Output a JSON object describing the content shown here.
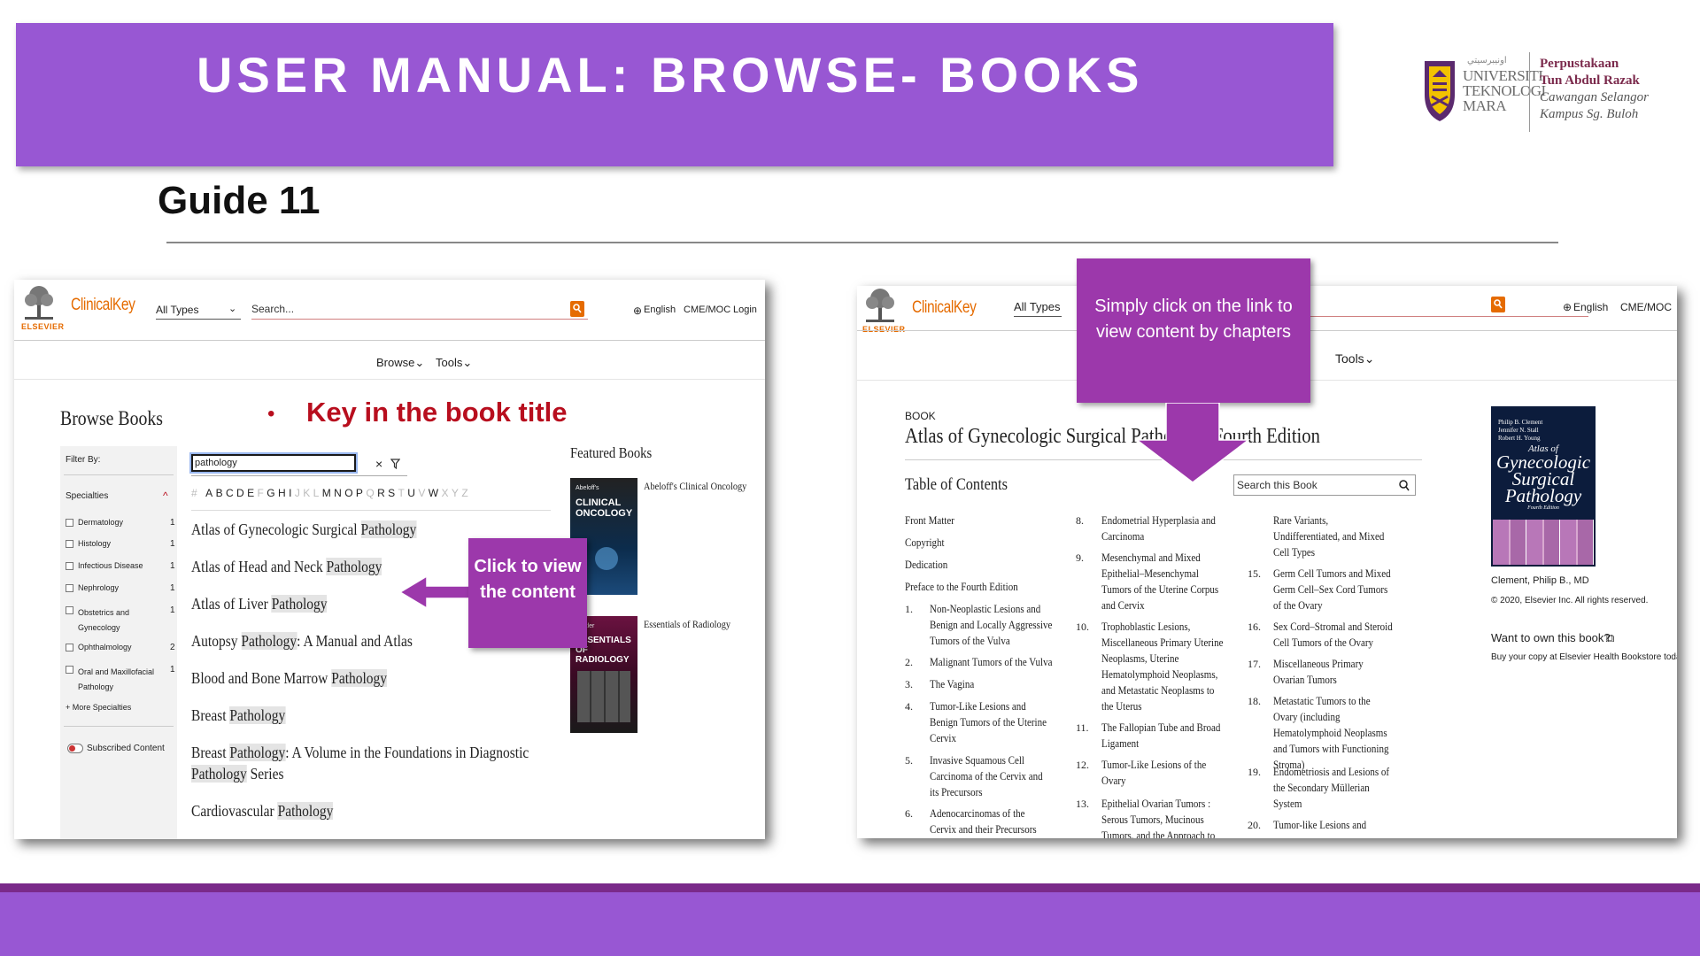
{
  "slide": {
    "title": "USER MANUAL: BROWSE- BOOKS",
    "guide": "Guide 11",
    "bullet": "Key in the book title",
    "callout_left": "Click to view the content",
    "callout_right": "Simply click on the link to view content by chapters",
    "accent_color": "#9857d3",
    "callout_color": "#9c38ab",
    "bullet_color": "#b80e1e"
  },
  "logo": {
    "university": [
      "UNIVERSITI",
      "TEKNOLOGI",
      "MARA"
    ],
    "library": [
      "Perpustakaan",
      "Tun Abdul Razak",
      "Cawangan Selangor",
      "Kampus Sg. Buloh"
    ],
    "crest": "uitm-crest-icon"
  },
  "left_shot": {
    "brand": "ClinicalKey",
    "publisher": "ELSEVIER",
    "type_select": "All Types",
    "search_placeholder": "Search...",
    "lang": "English",
    "cme": "CME/MOC",
    "login": "Login",
    "nav": [
      "Browse",
      "Tools"
    ],
    "heading": "Browse Books",
    "filter_by": "Filter By:",
    "specialties_label": "Specialties",
    "specialties": [
      {
        "name": "Dermatology",
        "count": "1"
      },
      {
        "name": "Histology",
        "count": "1"
      },
      {
        "name": "Infectious Disease",
        "count": "1"
      },
      {
        "name": "Nephrology",
        "count": "1"
      },
      {
        "name": "Obstetrics and Gynecology",
        "count": "1"
      },
      {
        "name": "Ophthalmology",
        "count": "2"
      },
      {
        "name": "Oral and Maxillofacial Pathology",
        "count": "1"
      }
    ],
    "more": "+ More Specialties",
    "subscribed": "Subscribed Content",
    "search_value": "pathology",
    "alphabet": [
      "#",
      "A",
      "B",
      "C",
      "D",
      "E",
      "F",
      "G",
      "H",
      "I",
      "J",
      "K",
      "L",
      "M",
      "N",
      "O",
      "P",
      "Q",
      "R",
      "S",
      "T",
      "U",
      "V",
      "W",
      "X",
      "Y",
      "Z"
    ],
    "alphabet_dim": [
      "#",
      "F",
      "J",
      "K",
      "L",
      "Q",
      "T",
      "V",
      "X",
      "Y",
      "Z"
    ],
    "books": [
      {
        "pre": "Atlas of Gynecologic Surgical ",
        "hl": "Pathology",
        "post": ""
      },
      {
        "pre": "Atlas of Head and Neck ",
        "hl": "Pathology",
        "post": ""
      },
      {
        "pre": "Atlas of Liver ",
        "hl": "Pathology",
        "post": ""
      },
      {
        "pre": "Autopsy ",
        "hl": "Pathology",
        "post": ": A Manual and Atlas"
      },
      {
        "pre": "Blood and Bone Marrow ",
        "hl": "Pathology",
        "post": ""
      },
      {
        "pre": "Breast ",
        "hl": "Pathology",
        "post": ""
      },
      {
        "pre": "Breast ",
        "hl": "Pathology",
        "post": ": A Volume in the Foundations in Diagnostic"
      },
      {
        "pre": "",
        "hl": "Pathology",
        "post": " Series"
      },
      {
        "pre": "Cardiovascular ",
        "hl": "Pathology",
        "post": ""
      }
    ],
    "featured": "Featured Books",
    "featured_books": [
      {
        "caption": "Abeloff's Clinical Oncology",
        "cover_top": "Abeloff's",
        "cover_main": "CLINICAL ONCOLOGY"
      },
      {
        "caption": "Essentials of Radiology",
        "cover_top": "Mettler",
        "cover_main": "ESSENTIALS OF RADIOLOGY"
      }
    ]
  },
  "right_shot": {
    "brand": "ClinicalKey",
    "publisher": "ELSEVIER",
    "type_select": "All Types",
    "lang": "English",
    "cme": "CME/MOC",
    "nav_tools": "Tools",
    "book_label": "BOOK",
    "book_title": "Atlas of Gynecologic Surgical Pathology, Fourth Edition",
    "toc_heading": "Table of Contents",
    "toc_search": "Search this Book",
    "front": [
      "Front Matter",
      "Copyright",
      "Dedication",
      "Preface to the Fourth Edition"
    ],
    "col1": [
      {
        "n": "1.",
        "t": "Non-Neoplastic Lesions and Benign and Locally Aggressive Tumors of the Vulva"
      },
      {
        "n": "2.",
        "t": "Malignant Tumors of the Vulva"
      },
      {
        "n": "3.",
        "t": "The Vagina"
      },
      {
        "n": "4.",
        "t": "Tumor-Like Lesions and Benign Tumors of the Uterine Cervix"
      },
      {
        "n": "5.",
        "t": "Invasive Squamous Cell Carcinoma of the Cervix and its Precursors"
      },
      {
        "n": "6.",
        "t": "Adenocarcinomas of the Cervix and their Precursors and"
      }
    ],
    "col2": [
      {
        "n": "8.",
        "t": "Endometrial Hyperplasia and Carcinoma"
      },
      {
        "n": "9.",
        "t": "Mesenchymal and Mixed Epithelial–Mesenchymal Tumors of the Uterine Corpus and Cervix"
      },
      {
        "n": "10.",
        "t": "Trophoblastic Lesions, Miscellaneous Primary Uterine Neoplasms, Uterine Hematolymphoid Neoplasms, and Metastatic Neoplasms to the Uterus"
      },
      {
        "n": "11.",
        "t": "The Fallopian Tube and Broad Ligament"
      },
      {
        "n": "12.",
        "t": "Tumor-Like Lesions of the Ovary"
      },
      {
        "n": "13.",
        "t": "Epithelial Ovarian Tumors : Serous Tumors, Mucinous Tumors, and the Approach to"
      }
    ],
    "col3": [
      {
        "n": "",
        "t": "Rare Variants, Undifferentiated, and Mixed Cell Types"
      },
      {
        "n": "15.",
        "t": "Germ Cell Tumors and Mixed Germ Cell–Sex Cord Tumors of the Ovary"
      },
      {
        "n": "16.",
        "t": "Sex Cord–Stromal and Steroid Cell Tumors of the Ovary"
      },
      {
        "n": "17.",
        "t": "Miscellaneous Primary Ovarian Tumors"
      },
      {
        "n": "18.",
        "t": "Metastatic Tumors to the Ovary (including Hematolymphoid Neoplasms and Tumors with Functioning Stroma)"
      },
      {
        "n": "19.",
        "t": "Endometriosis and Lesions of the Secondary Müllerian System"
      },
      {
        "n": "20.",
        "t": "Tumor-like Lesions and"
      }
    ],
    "cover_authors": [
      "Philip B. Clement",
      "Jennifer N. Stall",
      "Robert H. Young"
    ],
    "cover_title": [
      "Atlas of",
      "Gynecologic",
      "Surgical",
      "Pathology"
    ],
    "cover_edition": "Fourth Edition",
    "author": "Clement, Philip B., MD",
    "copyright": "© 2020, Elsevier Inc. All rights reserved.",
    "own": "Want to own this book?",
    "buy": "Buy your copy at Elsevier Health Bookstore today"
  }
}
